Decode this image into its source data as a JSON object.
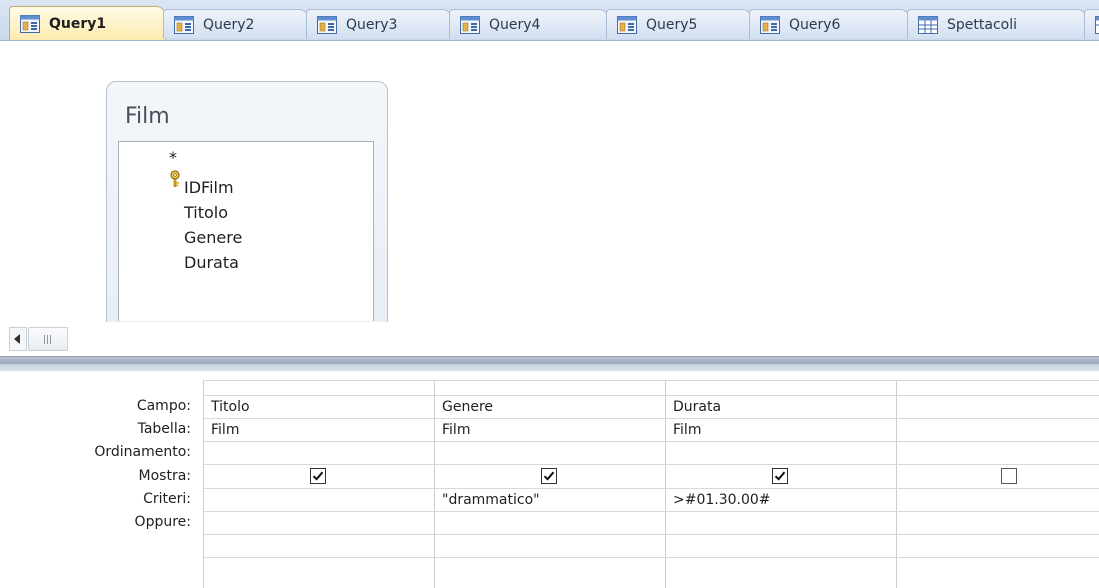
{
  "tabs": [
    {
      "label": "Query1",
      "icon": "query-icon",
      "active": true
    },
    {
      "label": "Query2",
      "icon": "query-icon",
      "active": false
    },
    {
      "label": "Query3",
      "icon": "query-icon",
      "active": false
    },
    {
      "label": "Query4",
      "icon": "query-icon",
      "active": false
    },
    {
      "label": "Query5",
      "icon": "query-icon",
      "active": false
    },
    {
      "label": "Query6",
      "icon": "query-icon",
      "active": false
    },
    {
      "label": "Spettacoli",
      "icon": "table-icon",
      "active": false
    }
  ],
  "table": {
    "title": "Film",
    "fields": [
      "*",
      "IDFilm",
      "Titolo",
      "Genere",
      "Durata"
    ],
    "primary_key": "IDFilm"
  },
  "grid": {
    "row_labels": {
      "field": "Campo:",
      "table": "Tabella:",
      "sort": "Ordinamento:",
      "show": "Mostra:",
      "criteria": "Criteri:",
      "or": "Oppure:"
    },
    "columns": [
      {
        "field": "Titolo",
        "table": "Film",
        "sort": "",
        "show": true,
        "criteria": "",
        "or": ""
      },
      {
        "field": "Genere",
        "table": "Film",
        "sort": "",
        "show": true,
        "criteria": "\"drammatico\"",
        "or": ""
      },
      {
        "field": "Durata",
        "table": "Film",
        "sort": "",
        "show": true,
        "criteria": ">#01.30.00#",
        "or": ""
      },
      {
        "field": "",
        "table": "",
        "sort": "",
        "show": false,
        "criteria": "",
        "or": ""
      }
    ]
  },
  "colors": {
    "active_tab": "#fdeab0",
    "tab_strip": "#c9d8ec",
    "splitter": "#9da9bb"
  }
}
